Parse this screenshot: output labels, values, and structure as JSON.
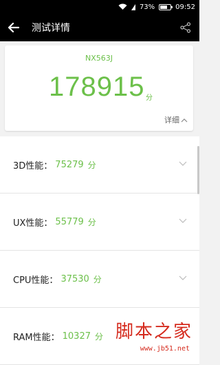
{
  "status_bar": {
    "battery_percent": "73%",
    "time": "09:52",
    "battery_level": 0.73
  },
  "app_bar": {
    "title": "测试详情"
  },
  "score_card": {
    "device": "NX563J",
    "total": "178915",
    "unit": "分",
    "detail_label": "详细"
  },
  "results": [
    {
      "label": "3D性能：",
      "value": "75279",
      "unit": "分"
    },
    {
      "label": "UX性能：",
      "value": "55779",
      "unit": "分"
    },
    {
      "label": "CPU性能：",
      "value": "37530",
      "unit": "分"
    },
    {
      "label": "RAM性能：",
      "value": "10327",
      "unit": "分"
    }
  ],
  "watermark": {
    "main": "脚本之家",
    "sub": "www.jb51.net"
  },
  "colors": {
    "accent_green": "#6cc04a",
    "watermark_red": "#d52b1e"
  }
}
